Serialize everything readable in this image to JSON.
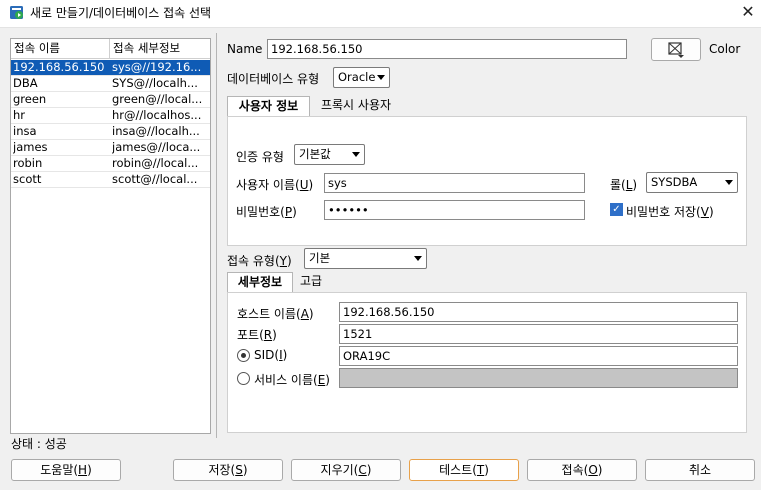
{
  "window": {
    "title": "새로 만들기/데이터베이스 접속 선택",
    "close_glyph": "✕"
  },
  "list": {
    "col1": "접속 이름",
    "col2": "접속 세부정보",
    "rows": [
      {
        "name": "192.168.56.150",
        "detail": "sys@//192.16..."
      },
      {
        "name": "DBA",
        "detail": "SYS@//localh..."
      },
      {
        "name": "green",
        "detail": "green@//local..."
      },
      {
        "name": "hr",
        "detail": "hr@//localhos..."
      },
      {
        "name": "insa",
        "detail": "insa@//localh..."
      },
      {
        "name": "james",
        "detail": "james@//loca..."
      },
      {
        "name": "robin",
        "detail": "robin@//local..."
      },
      {
        "name": "scott",
        "detail": "scott@//local..."
      }
    ]
  },
  "form": {
    "name_label": "Name",
    "name_value": "192.168.56.150",
    "color_label": "Color",
    "dbtype_label": "데이터베이스 유형",
    "dbtype_value": "Oracle",
    "tabs1": [
      "사용자 정보",
      "프록시 사용자"
    ],
    "auth_label": "인증 유형",
    "auth_value": "기본값",
    "user_label": "사용자 이름(U)",
    "user_value": "sys",
    "role_label": "롤(L)",
    "role_value": "SYSDBA",
    "pw_label": "비밀번호(P)",
    "pw_value": "••••••",
    "save_pw_label": "비밀번호 저장(V)",
    "conn_type_label": "접속 유형(Y)",
    "conn_type_value": "기본",
    "tabs2": [
      "세부정보",
      "고급"
    ],
    "host_label": "호스트 이름(A)",
    "host_value": "192.168.56.150",
    "port_label": "포트(R)",
    "port_value": "1521",
    "sid_label": "SID(I)",
    "sid_value": "ORA19C",
    "service_label": "서비스 이름(E)",
    "service_value": ""
  },
  "status": "상태 : 성공",
  "buttons": {
    "help": "도움말(H)",
    "save": "저장(S)",
    "clear": "지우기(C)",
    "test": "테스트(T)",
    "connect": "접속(O)",
    "cancel": "취소"
  }
}
